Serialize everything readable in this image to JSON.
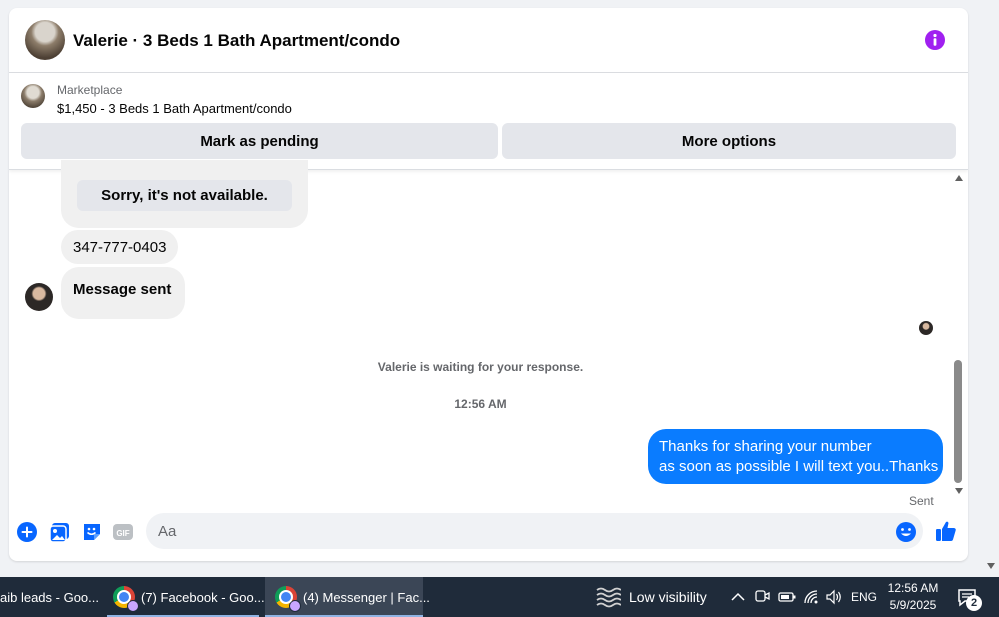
{
  "colors": {
    "accent": "#0a7cff",
    "composer_icon": "#0866ff",
    "info_icon": "#a020f0",
    "taskbar": "#1f2b3a"
  },
  "header": {
    "title": "Valerie · 3 Beds 1 Bath Apartment/condo",
    "info_icon": "info-icon"
  },
  "listing": {
    "source": "Marketplace",
    "summary": "$1,450 - 3 Beds 1 Bath Apartment/condo",
    "mark_pending_label": "Mark as pending",
    "more_options_label": "More options"
  },
  "messages": {
    "reply_chip": "Sorry, it's not available.",
    "phone_message": "347-777-0403",
    "message_sent": "Message sent",
    "waiting_notice": "Valerie is waiting for your response.",
    "timestamp": "12:56 AM",
    "outgoing": {
      "line1": "Thanks for sharing your number",
      "line2": "as soon as possible I will text you..Thanks"
    },
    "delivery_status": "Sent"
  },
  "composer": {
    "placeholder": "Aa",
    "icons": [
      "plus-icon",
      "photo-icon",
      "sticker-icon",
      "gif-icon",
      "emoji-icon",
      "thumbs-up-icon"
    ],
    "gif_label": "GIF"
  },
  "taskbar": {
    "tasks": [
      {
        "label": "aib leads - Goo..."
      },
      {
        "label": "(7) Facebook - Goo..."
      },
      {
        "label": "(4) Messenger | Fac..."
      }
    ],
    "weather": "Low visibility",
    "language": "ENG",
    "time": "12:56 AM",
    "date": "5/9/2025",
    "notification_count": "2"
  }
}
